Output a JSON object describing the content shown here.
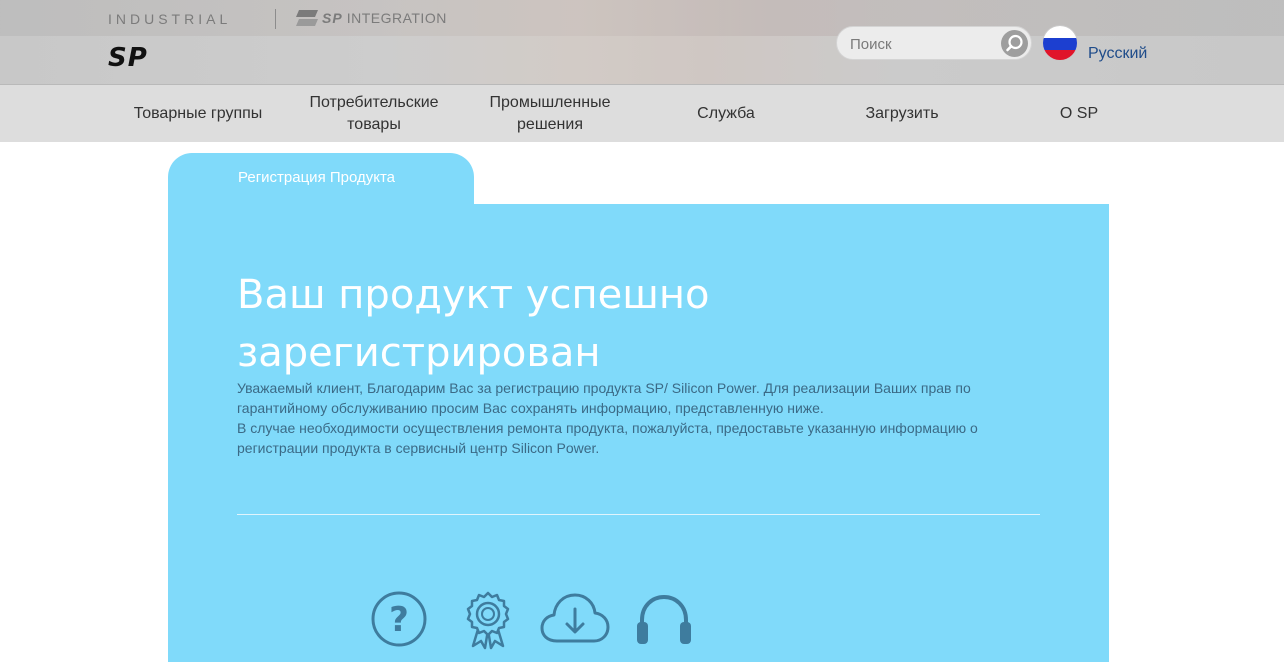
{
  "header": {
    "industrial_label": "INDUSTRIAL",
    "integration_logo": "SP",
    "integration_label": "INTEGRATION",
    "logo_text": "SP",
    "search_placeholder": "Поиск",
    "language": "Русский"
  },
  "nav": {
    "items": [
      {
        "label": "Товарные группы"
      },
      {
        "label": "Потребительские\nтовары"
      },
      {
        "label": "Промышленные\nрешения"
      },
      {
        "label": "Служба"
      },
      {
        "label": "Загрузить"
      },
      {
        "label": "О SP"
      }
    ]
  },
  "content": {
    "tab_label": "Регистрация Продукта",
    "heading": "Ваш продукт успешно зарегистрирован",
    "paragraph_1": "Уважаемый клиент, Благодарим Вас за регистрацию продукта SP/ Silicon Power. Для реализации Ваших прав по гарантийному обслуживанию просим Вас сохранять информацию, представленную ниже.",
    "paragraph_2": "В случае необходимости осуществления ремонта продукта, пожалуйста, предоставьте указанную информацию о регистрации продукта в сервисный центр Silicon Power."
  },
  "icons": [
    "question-icon",
    "award-ribbon-icon",
    "cloud-download-icon",
    "headphones-icon"
  ],
  "colors": {
    "panel": "#80dafa",
    "nav_bg": "#dddddd",
    "topbar_bg": "#c8c8c8",
    "icon": "#3e7c9e",
    "link": "#1f4c8a"
  }
}
